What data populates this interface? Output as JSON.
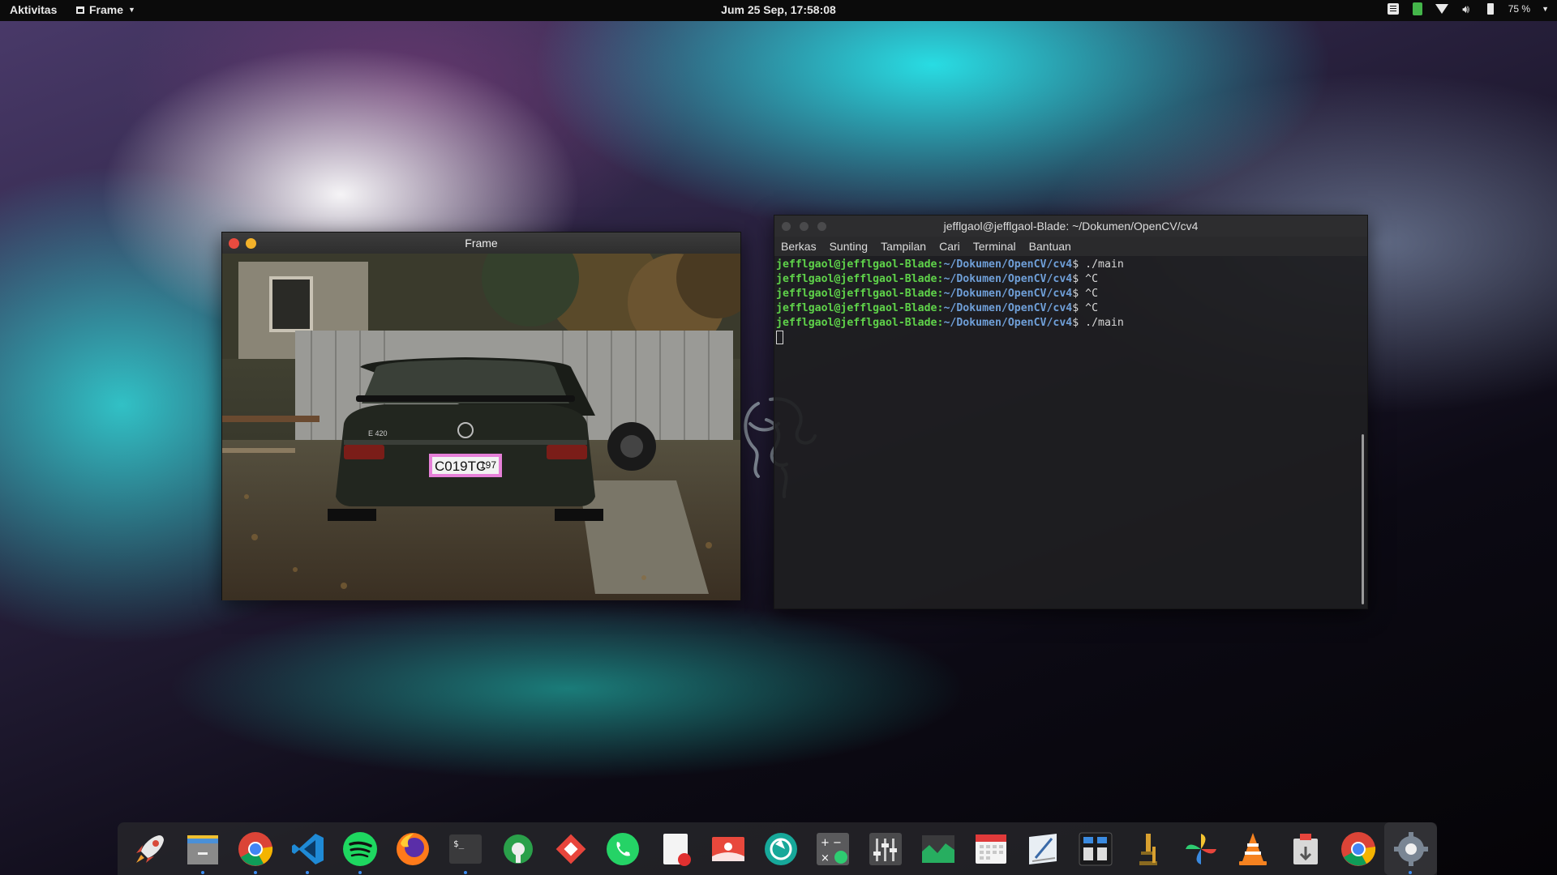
{
  "topbar": {
    "activities": "Aktivitas",
    "app_menu": "Frame",
    "clock": "Jum 25 Sep, 17:58:08",
    "battery_percent": "75 %"
  },
  "frame_window": {
    "title": "Frame",
    "plate_text": "C019TC",
    "plate_region": "197",
    "car_badge": "E 420"
  },
  "terminal": {
    "title": "jefflgaol@jefflgaol-Blade: ~/Dokumen/OpenCV/cv4",
    "menu": [
      "Berkas",
      "Sunting",
      "Tampilan",
      "Cari",
      "Terminal",
      "Bantuan"
    ],
    "lines": [
      {
        "user": "jefflgaol@jefflgaol-Blade",
        "path": "~/Dokumen/OpenCV/cv4",
        "cmd": "$ ./main"
      },
      {
        "user": "jefflgaol@jefflgaol-Blade",
        "path": "~/Dokumen/OpenCV/cv4",
        "cmd": "$ ^C"
      },
      {
        "user": "jefflgaol@jefflgaol-Blade",
        "path": "~/Dokumen/OpenCV/cv4",
        "cmd": "$ ^C"
      },
      {
        "user": "jefflgaol@jefflgaol-Blade",
        "path": "~/Dokumen/OpenCV/cv4",
        "cmd": "$ ^C"
      },
      {
        "user": "jefflgaol@jefflgaol-Blade",
        "path": "~/Dokumen/OpenCV/cv4",
        "cmd": "$ ./main"
      }
    ]
  },
  "dock": {
    "items": [
      {
        "icon": "rocket-launcher-icon",
        "running": false
      },
      {
        "icon": "files-icon",
        "running": true
      },
      {
        "icon": "chrome-icon",
        "running": true
      },
      {
        "icon": "vscode-icon",
        "running": true
      },
      {
        "icon": "spotify-icon",
        "running": true
      },
      {
        "icon": "firefox-icon",
        "running": false
      },
      {
        "icon": "terminal-icon",
        "running": true
      },
      {
        "icon": "tweaks-icon",
        "running": false
      },
      {
        "icon": "anydesk-icon",
        "running": false
      },
      {
        "icon": "whatsapp-icon",
        "running": false
      },
      {
        "icon": "text-editor-icon",
        "running": false
      },
      {
        "icon": "image-viewer-icon",
        "running": false
      },
      {
        "icon": "aperture-icon",
        "running": false
      },
      {
        "icon": "calculator-icon",
        "running": false
      },
      {
        "icon": "mixer-icon",
        "running": false
      },
      {
        "icon": "system-monitor-icon",
        "running": false
      },
      {
        "icon": "calendar-icon",
        "running": false
      },
      {
        "icon": "writer-icon",
        "running": false
      },
      {
        "icon": "app-grid-icon",
        "running": false
      },
      {
        "icon": "microscope-icon",
        "running": false
      },
      {
        "icon": "pinwheel-icon",
        "running": false
      },
      {
        "icon": "vlc-icon",
        "running": false
      },
      {
        "icon": "archive-manager-icon",
        "running": false
      },
      {
        "icon": "chrome-alt-icon",
        "running": false
      },
      {
        "icon": "settings-icon",
        "running": true
      }
    ]
  }
}
